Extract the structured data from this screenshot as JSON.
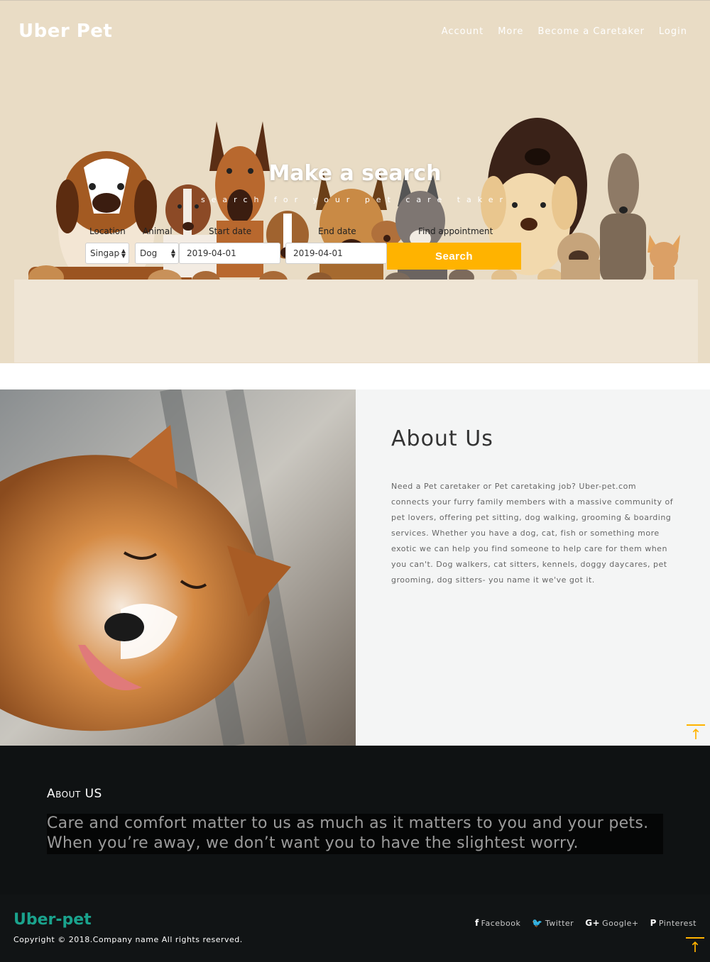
{
  "header": {
    "brand": "Uber Pet",
    "nav": [
      "Account",
      "More",
      "Become a Caretaker",
      "Login"
    ]
  },
  "hero": {
    "title": "Make a search",
    "subtitle": "search for your pet care taker",
    "labels": {
      "location": "Location",
      "animal": "Animal",
      "start_date": "Start date",
      "end_date": "End date",
      "find": "Find appointment"
    },
    "values": {
      "location": "Singapore",
      "animal": "Dog",
      "start_date": "2019-04-01",
      "end_date": "2019-04-01"
    },
    "search_button": "Search"
  },
  "about": {
    "title": "About Us",
    "text": "Need a Pet caretaker or Pet caretaking job? Uber-pet.com connects your furry family members with a massive community of pet lovers, offering pet sitting, dog walking, grooming & boarding services. Whether you have a dog, cat, fish or something more exotic we can help you find someone to help care for them when you can't. Dog walkers, cat sitters, kennels, doggy daycares, pet grooming, dog sitters- you name it we've got it."
  },
  "band": {
    "heading": "About US",
    "quote": "Care and comfort matter to us as much as it matters to you and your pets. When you’re away, we don’t want you to have the slightest worry."
  },
  "footer": {
    "brand": "Uber-pet",
    "copyright": "Copyright © 2018.Company name All rights reserved.",
    "social": [
      {
        "icon": "f",
        "label": "Facebook"
      },
      {
        "icon": "🐦",
        "label": "Twitter"
      },
      {
        "icon": "G+",
        "label": "Google+"
      },
      {
        "icon": "P",
        "label": "Pinterest"
      }
    ]
  },
  "colors": {
    "hero_bg": "#e9dcc5",
    "accent": "#ffb300",
    "footer_brand": "#1aa38d",
    "dark_bg": "#0f1213"
  },
  "icons": [
    "back-to-top-arrow-icon",
    "facebook-icon",
    "twitter-icon",
    "google-plus-icon",
    "pinterest-icon"
  ]
}
